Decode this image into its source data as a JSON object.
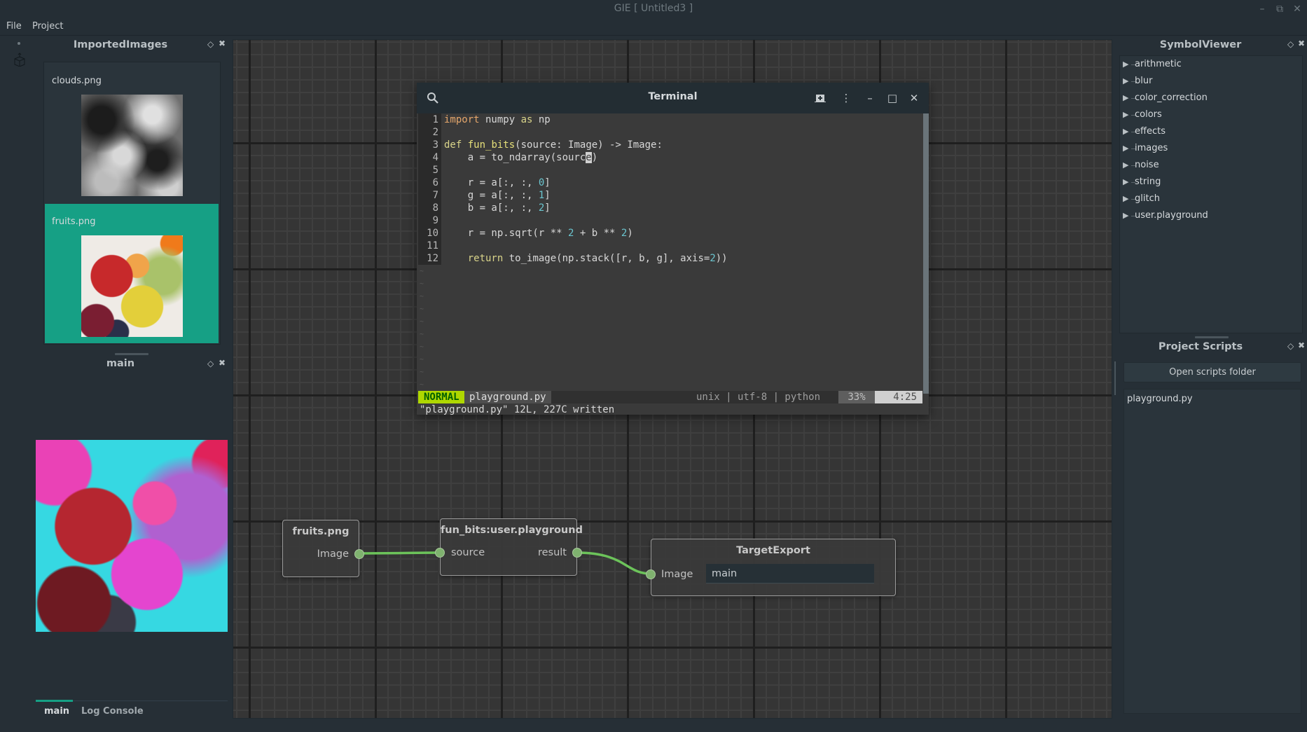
{
  "window": {
    "title": "GIE [ Untitled3 ]",
    "controls": [
      "minimize",
      "restore",
      "close"
    ]
  },
  "menu": {
    "items": [
      "File",
      "Project"
    ]
  },
  "left_panel": {
    "imported_images": {
      "title": "ImportedImages",
      "items": [
        {
          "label": "clouds.png",
          "selected": false
        },
        {
          "label": "fruits.png",
          "selected": true
        }
      ],
      "selected_color": "#16a085"
    },
    "preview_dock": {
      "title": "main"
    },
    "bottom_tabs": [
      {
        "label": "main",
        "active": true
      },
      {
        "label": "Log Console",
        "active": false
      }
    ]
  },
  "terminal": {
    "title": "Terminal",
    "code_lines": [
      {
        "n": "1",
        "text": "import numpy as np"
      },
      {
        "n": "2",
        "text": ""
      },
      {
        "n": "3",
        "text": "def fun_bits(source: Image) -> Image:"
      },
      {
        "n": "4",
        "text": "    a = to_ndarray(source)"
      },
      {
        "n": "5",
        "text": ""
      },
      {
        "n": "6",
        "text": "    r = a[:, :, 0]"
      },
      {
        "n": "7",
        "text": "    g = a[:, :, 1]"
      },
      {
        "n": "8",
        "text": "    b = a[:, :, 2]"
      },
      {
        "n": "9",
        "text": ""
      },
      {
        "n": "10",
        "text": "    r = np.sqrt(r ** 2 + b ** 2)"
      },
      {
        "n": "11",
        "text": ""
      },
      {
        "n": "12",
        "text": "    return to_image(np.stack([r, b, g], axis=2))"
      }
    ],
    "cursor": {
      "line": 4,
      "col": 25
    },
    "status": {
      "mode": "NORMAL",
      "filename": "playground.py",
      "fileinfo": "unix | utf-8 | python",
      "percent": "33%",
      "position": "4:25"
    },
    "message": "\"playground.py\" 12L, 227C written"
  },
  "graph": {
    "nodes": [
      {
        "id": "fruits",
        "title": "fruits.png",
        "outputs": [
          "Image"
        ]
      },
      {
        "id": "funbits",
        "title": "fun_bits:user.playground",
        "inputs": [
          "source"
        ],
        "outputs": [
          "result"
        ]
      },
      {
        "id": "export",
        "title": "TargetExport",
        "inputs": [
          "Image"
        ],
        "field_value": "main"
      }
    ],
    "edges": [
      {
        "from": "fruits.Image",
        "to": "funbits.source"
      },
      {
        "from": "funbits.result",
        "to": "export.Image"
      }
    ],
    "edge_color": "#6cc35a"
  },
  "right_panel": {
    "symbol_viewer": {
      "title": "SymbolViewer",
      "items": [
        "arithmetic",
        "blur",
        "color_correction",
        "colors",
        "effects",
        "images",
        "noise",
        "string",
        "glitch",
        "user.playground"
      ]
    },
    "project_scripts": {
      "title": "Project Scripts",
      "open_folder_label": "Open scripts folder",
      "scripts": [
        "playground.py"
      ]
    }
  }
}
